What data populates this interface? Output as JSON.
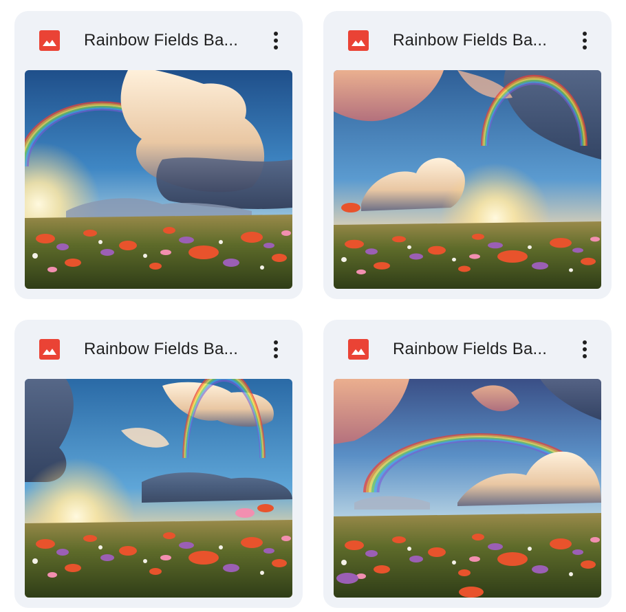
{
  "files": [
    {
      "title": "Rainbow Fields Ba...",
      "icon": "image-file-icon",
      "menu_icon": "more-vert-icon",
      "accent": "#ea4335"
    },
    {
      "title": "Rainbow Fields Ba...",
      "icon": "image-file-icon",
      "menu_icon": "more-vert-icon",
      "accent": "#ea4335"
    },
    {
      "title": "Rainbow Fields Ba...",
      "icon": "image-file-icon",
      "menu_icon": "more-vert-icon",
      "accent": "#ea4335"
    },
    {
      "title": "Rainbow Fields Ba...",
      "icon": "image-file-icon",
      "menu_icon": "more-vert-icon",
      "accent": "#ea4335"
    }
  ],
  "colors": {
    "card_background": "#eff2f7",
    "title_text": "#1f1f1f",
    "image_icon": "#ea4335"
  }
}
